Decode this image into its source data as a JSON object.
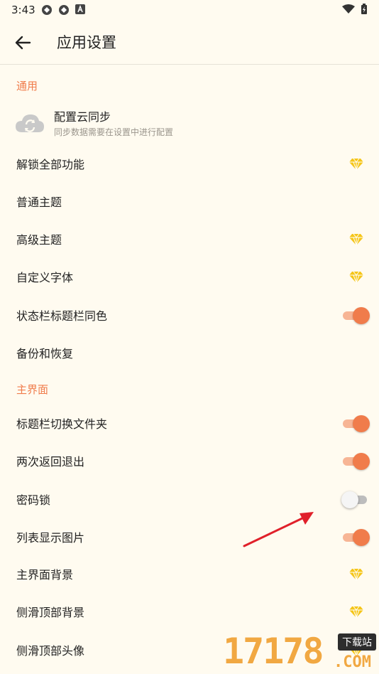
{
  "status_bar": {
    "time": "3:43"
  },
  "app_bar": {
    "title": "应用设置"
  },
  "sections": {
    "general": "通用",
    "main_ui": "主界面"
  },
  "cloud_sync": {
    "title": "配置云同步",
    "subtitle": "同步数据需要在设置中进行配置"
  },
  "rows": {
    "unlock_all": "解锁全部功能",
    "normal_theme": "普通主题",
    "premium_theme": "高级主题",
    "custom_font": "自定义字体",
    "statusbar_same_color": "状态栏标题栏同色",
    "backup_restore": "备份和恢复",
    "titlebar_switch_folder": "标题栏切换文件夹",
    "double_back_exit": "两次返回退出",
    "password_lock": "密码锁",
    "list_show_image": "列表显示图片",
    "main_bg": "主界面背景",
    "drawer_top_bg": "侧滑顶部背景",
    "drawer_top_avatar": "侧滑顶部头像"
  },
  "toggles": {
    "statusbar_same_color": true,
    "titlebar_switch_folder": true,
    "double_back_exit": true,
    "password_lock": false,
    "list_show_image": true
  },
  "watermark": {
    "digits": "17178",
    "tag": "下载站",
    "domain": ".COM"
  },
  "colors": {
    "accent": "#f07c4b",
    "premium": "#f5c518",
    "background": "#fffbf0",
    "annotation_arrow": "#e0202a"
  }
}
